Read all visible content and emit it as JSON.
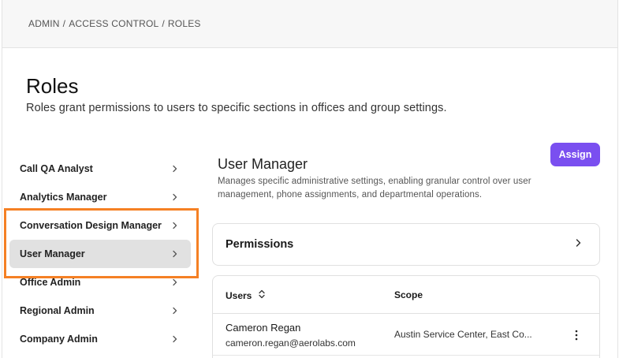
{
  "breadcrumb": [
    "ADMIN",
    "ACCESS CONTROL",
    "ROLES"
  ],
  "breadcrumb_separator": "/",
  "page": {
    "title": "Roles",
    "description": "Roles grant permissions to users to specific sections in offices and group settings."
  },
  "roles": [
    {
      "label": "Call QA Analyst",
      "active": false
    },
    {
      "label": "Analytics Manager",
      "active": false
    },
    {
      "label": "Conversation Design Manager",
      "active": false
    },
    {
      "label": "User Manager",
      "active": true
    },
    {
      "label": "Office Admin",
      "active": false
    },
    {
      "label": "Regional Admin",
      "active": false
    },
    {
      "label": "Company Admin",
      "active": false
    }
  ],
  "detail": {
    "title": "User Manager",
    "description": "Manages specific administrative settings, enabling granular control over user management, phone assignments, and departmental operations.",
    "assign_label": "Assign",
    "permissions_label": "Permissions"
  },
  "users_table": {
    "columns": [
      "Users",
      "Scope"
    ],
    "rows": [
      {
        "name": "Cameron Regan",
        "email": "cameron.regan@aerolabs.com",
        "scope": "Austin Service Center, East Co..."
      }
    ]
  },
  "colors": {
    "accent": "#7a4ff0",
    "highlight": "#f58024",
    "active_bg": "#e1e1e1"
  },
  "icons": {
    "role_item": "chevron-right-icon",
    "sort": "sort-updown-icon",
    "row_menu": "kebab-menu-icon"
  }
}
